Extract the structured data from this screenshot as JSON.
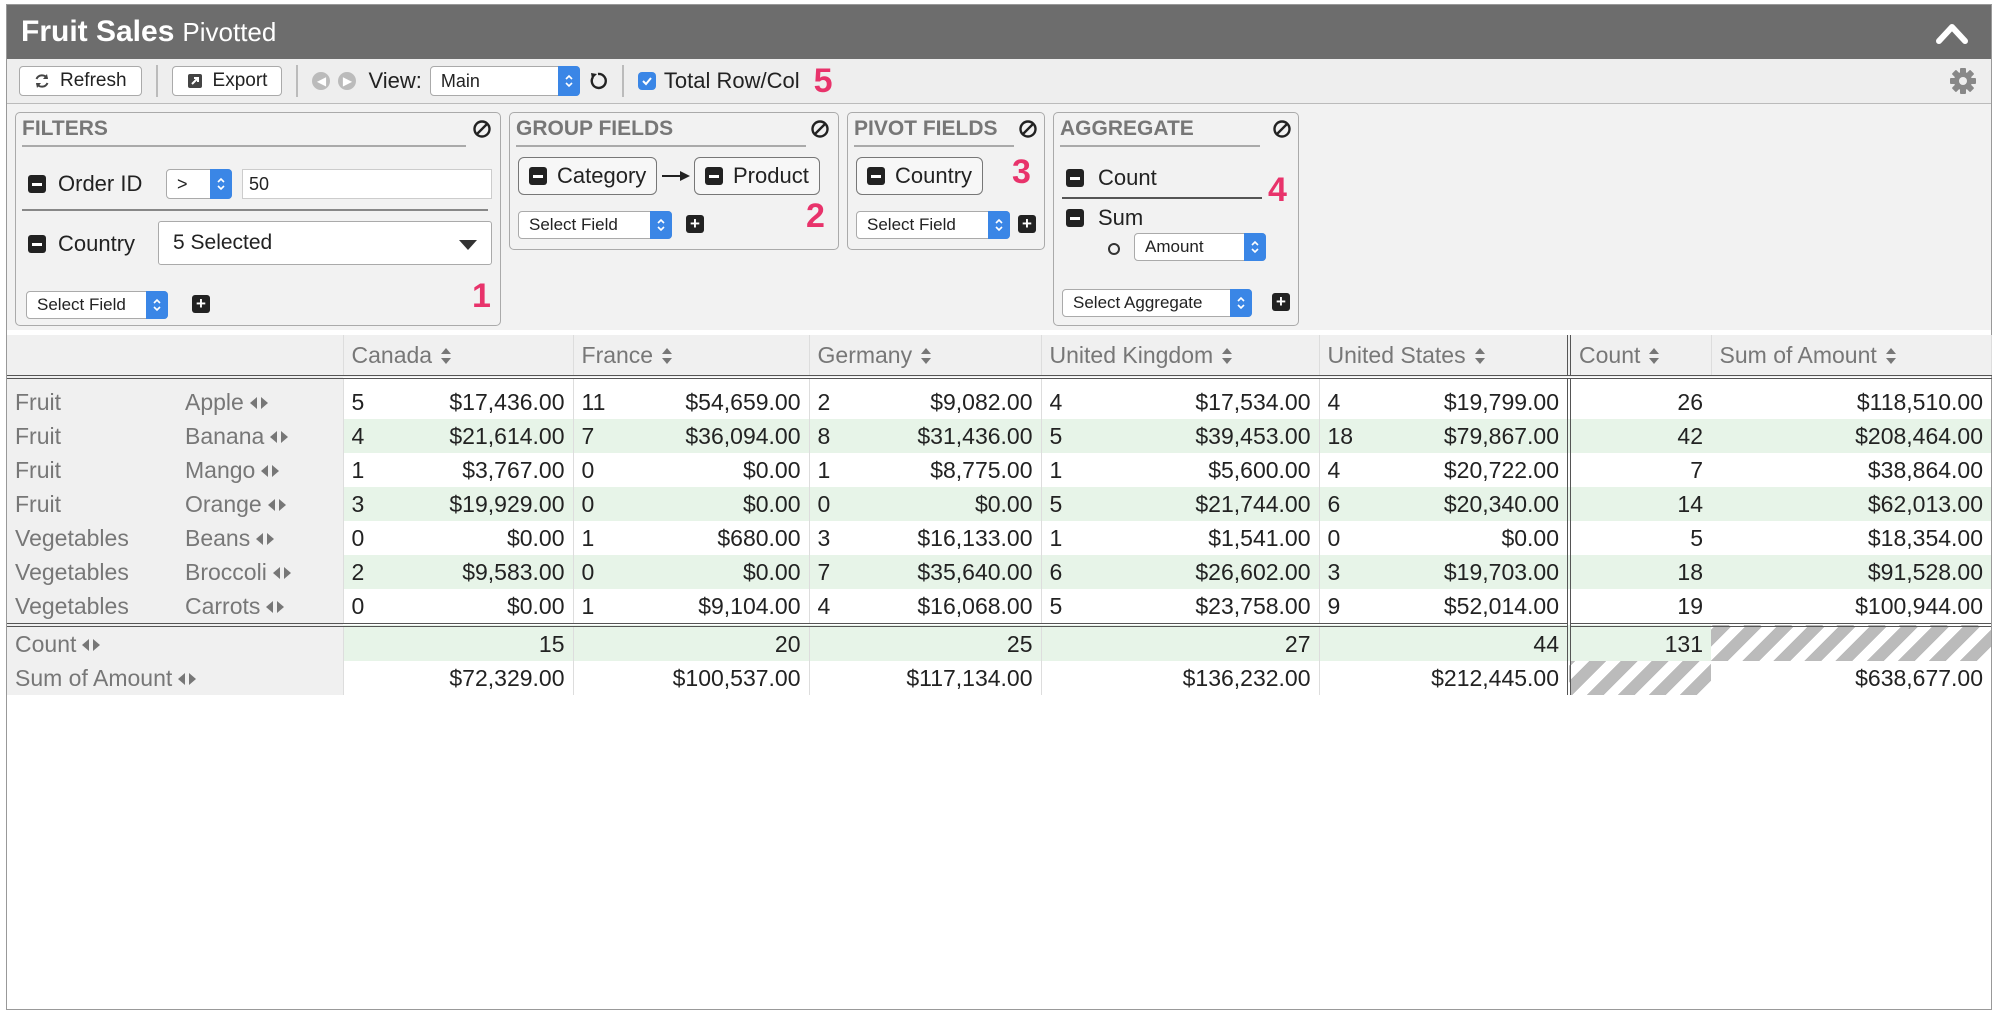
{
  "window": {
    "title": "Fruit Sales",
    "subtitle": "Pivotted"
  },
  "toolbar": {
    "refresh_label": "Refresh",
    "export_label": "Export",
    "view_label": "View:",
    "view_value": "Main",
    "total_label": "Total Row/Col",
    "total_checked": true
  },
  "callouts": [
    "1",
    "2",
    "3",
    "4",
    "5"
  ],
  "filters": {
    "title": "FILTERS",
    "order_id": {
      "label": "Order ID",
      "operator": ">",
      "value": "50"
    },
    "country": {
      "label": "Country",
      "value": "5 Selected"
    },
    "select_field": "Select Field"
  },
  "group_fields": {
    "title": "GROUP FIELDS",
    "fields": [
      "Category",
      "Product"
    ],
    "select_field": "Select Field"
  },
  "pivot_fields": {
    "title": "PIVOT FIELDS",
    "fields": [
      "Country"
    ],
    "select_field": "Select Field"
  },
  "aggregate": {
    "title": "AGGREGATE",
    "count_label": "Count",
    "sum_label": "Sum",
    "sum_field": "Amount",
    "select_aggregate": "Select Aggregate"
  },
  "table": {
    "columns": [
      "Canada",
      "France",
      "Germany",
      "United Kingdom",
      "United States",
      "Count",
      "Sum of Amount"
    ],
    "rows": [
      {
        "category": "Fruit",
        "product": "Apple",
        "cells": [
          [
            "5",
            "$17,436.00"
          ],
          [
            "11",
            "$54,659.00"
          ],
          [
            "2",
            "$9,082.00"
          ],
          [
            "4",
            "$17,534.00"
          ],
          [
            "4",
            "$19,799.00"
          ]
        ],
        "count": "26",
        "sum": "$118,510.00"
      },
      {
        "category": "Fruit",
        "product": "Banana",
        "cells": [
          [
            "4",
            "$21,614.00"
          ],
          [
            "7",
            "$36,094.00"
          ],
          [
            "8",
            "$31,436.00"
          ],
          [
            "5",
            "$39,453.00"
          ],
          [
            "18",
            "$79,867.00"
          ]
        ],
        "count": "42",
        "sum": "$208,464.00"
      },
      {
        "category": "Fruit",
        "product": "Mango",
        "cells": [
          [
            "1",
            "$3,767.00"
          ],
          [
            "0",
            "$0.00"
          ],
          [
            "1",
            "$8,775.00"
          ],
          [
            "1",
            "$5,600.00"
          ],
          [
            "4",
            "$20,722.00"
          ]
        ],
        "count": "7",
        "sum": "$38,864.00"
      },
      {
        "category": "Fruit",
        "product": "Orange",
        "cells": [
          [
            "3",
            "$19,929.00"
          ],
          [
            "0",
            "$0.00"
          ],
          [
            "0",
            "$0.00"
          ],
          [
            "5",
            "$21,744.00"
          ],
          [
            "6",
            "$20,340.00"
          ]
        ],
        "count": "14",
        "sum": "$62,013.00"
      },
      {
        "category": "Vegetables",
        "product": "Beans",
        "cells": [
          [
            "0",
            "$0.00"
          ],
          [
            "1",
            "$680.00"
          ],
          [
            "3",
            "$16,133.00"
          ],
          [
            "1",
            "$1,541.00"
          ],
          [
            "0",
            "$0.00"
          ]
        ],
        "count": "5",
        "sum": "$18,354.00"
      },
      {
        "category": "Vegetables",
        "product": "Broccoli",
        "cells": [
          [
            "2",
            "$9,583.00"
          ],
          [
            "0",
            "$0.00"
          ],
          [
            "7",
            "$35,640.00"
          ],
          [
            "6",
            "$26,602.00"
          ],
          [
            "3",
            "$19,703.00"
          ]
        ],
        "count": "18",
        "sum": "$91,528.00"
      },
      {
        "category": "Vegetables",
        "product": "Carrots",
        "cells": [
          [
            "0",
            "$0.00"
          ],
          [
            "1",
            "$9,104.00"
          ],
          [
            "4",
            "$16,068.00"
          ],
          [
            "5",
            "$23,758.00"
          ],
          [
            "9",
            "$52,014.00"
          ]
        ],
        "count": "19",
        "sum": "$100,944.00"
      }
    ],
    "totals": {
      "count_label": "Count",
      "sum_label": "Sum of Amount",
      "counts": [
        "15",
        "20",
        "25",
        "27",
        "44"
      ],
      "count_total": "131",
      "sums": [
        "$72,329.00",
        "$100,537.00",
        "$117,134.00",
        "$136,232.00",
        "$212,445.00"
      ],
      "sum_total": "$638,677.00"
    }
  },
  "colors": {
    "accent": "#3a86e6",
    "callout": "#e8336b",
    "row_alt": "#e7f4e8",
    "titlebar": "#6d6d6d"
  }
}
